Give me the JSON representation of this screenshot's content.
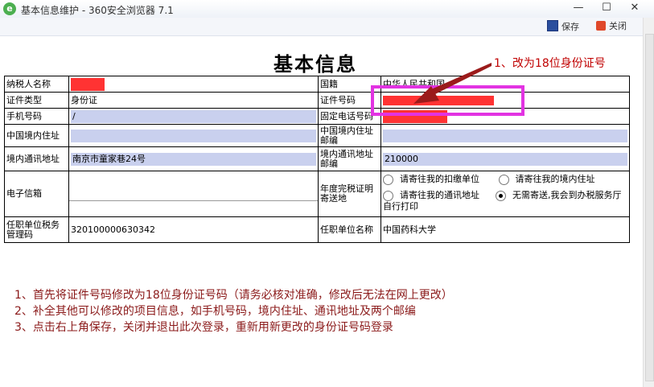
{
  "window": {
    "title": "基本信息维护 - 360安全浏览器 7.1",
    "app_icon": "e"
  },
  "toolbar": {
    "save_label": "保存",
    "close_label": "关闭"
  },
  "form": {
    "title": "基本信息",
    "taxpayer_name_label": "纳税人名称",
    "nationality_label": "国籍",
    "nationality_value": "中华人民共和国",
    "id_type_label": "证件类型",
    "id_type_value": "身份证",
    "id_number_label": "证件号码",
    "mobile_label": "手机号码",
    "mobile_value": "/",
    "landline_label": "固定电话号码",
    "domestic_address_label": "中国境内住址",
    "domestic_postcode_label": "中国境内住址邮编",
    "mail_address_label": "境内通讯地址",
    "mail_address_value": "南京市童家巷24号",
    "mail_postcode_label": "境内通讯地址邮编",
    "mail_postcode_value": "210000",
    "email_label": "电子信箱",
    "cert_mail_label": "年度完税证明寄送地",
    "options": [
      {
        "label": "请寄往我的扣缴单位",
        "selected": false
      },
      {
        "label": "请寄往我的境内住址",
        "selected": false
      },
      {
        "label": "请寄往我的通讯地址",
        "selected": false
      },
      {
        "label": "无需寄送,我会到办税服务厅自行打印",
        "selected": true
      }
    ],
    "employer_tax_label": "任职单位税务管理码",
    "employer_tax_value": "320100000630342",
    "employer_name_label": "任职单位名称",
    "employer_name_value": "中国药科大学"
  },
  "annotation": {
    "text": "1、改为18位身份证号",
    "color": "#c00000",
    "box_color": "#e233e2"
  },
  "notes": [
    "1、首先将证件号码修改为18位身份证号码（请务必核对准确，修改后无法在网上更改）",
    "2、补全其他可以修改的项目信息，如手机号码，境内住址、通讯地址及两个邮编",
    "3、点击右上角保存，关闭并退出此次登录，重新用新更改的身份证号码登录"
  ]
}
